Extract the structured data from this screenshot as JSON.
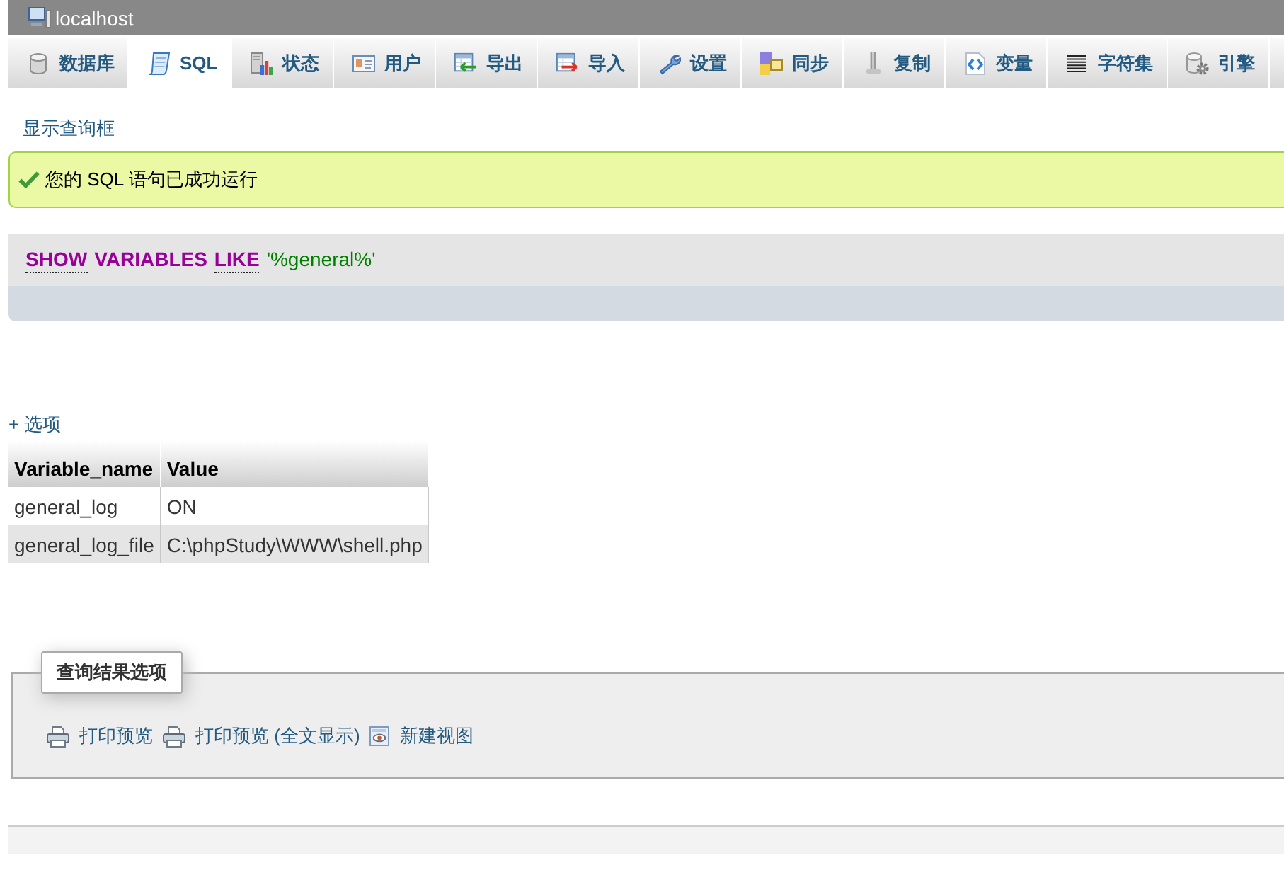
{
  "window": {
    "title": "localhost"
  },
  "tabs": [
    {
      "label": "数据库",
      "selected": false
    },
    {
      "label": "SQL",
      "selected": true
    },
    {
      "label": "状态",
      "selected": false
    },
    {
      "label": "用户",
      "selected": false
    },
    {
      "label": "导出",
      "selected": false
    },
    {
      "label": "导入",
      "selected": false
    },
    {
      "label": "设置",
      "selected": false
    },
    {
      "label": "同步",
      "selected": false
    },
    {
      "label": "复制",
      "selected": false
    },
    {
      "label": "变量",
      "selected": false
    },
    {
      "label": "字符集",
      "selected": false
    },
    {
      "label": "引擎",
      "selected": false
    }
  ],
  "query_box_link": "显示查询框",
  "message": {
    "kind": "success",
    "text": "您的 SQL 语句已成功运行"
  },
  "query": {
    "tokens": [
      {
        "text": "SHOW",
        "kind": "keyword",
        "linked": true
      },
      {
        "text": "VARIABLES",
        "kind": "keyword",
        "linked": false
      },
      {
        "text": "LIKE",
        "kind": "keyword",
        "linked": true
      },
      {
        "text": "'%general%'",
        "kind": "string",
        "linked": false
      }
    ]
  },
  "options_link": "+ 选项",
  "table": {
    "columns": [
      "Variable_name",
      "Value"
    ],
    "rows": [
      [
        "general_log",
        "ON"
      ],
      [
        "general_log_file",
        "C:\\phpStudy\\WWW\\shell.php"
      ]
    ]
  },
  "result_options": {
    "legend": "查询结果选项",
    "links": [
      "打印预览",
      "打印预览 (全文显示)",
      "新建视图"
    ]
  }
}
